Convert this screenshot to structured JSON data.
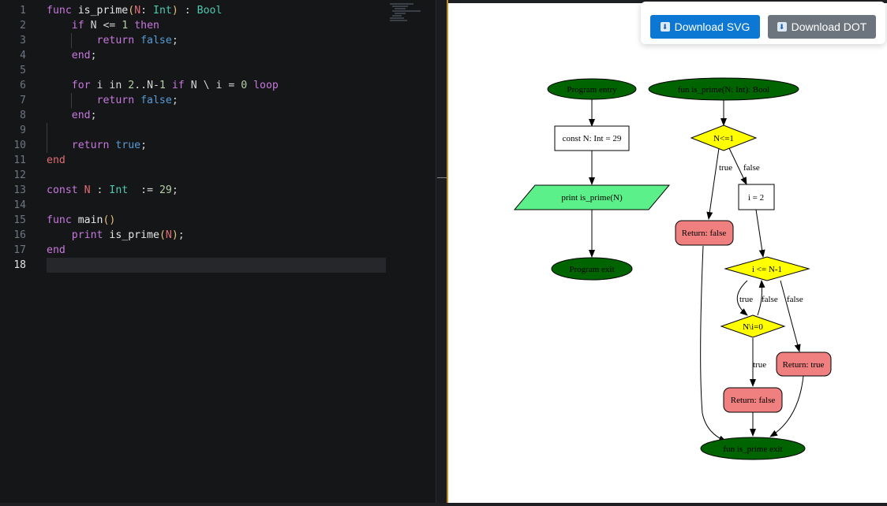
{
  "editor": {
    "line_numbers": [
      "1",
      "2",
      "3",
      "4",
      "5",
      "6",
      "7",
      "8",
      "9",
      "10",
      "11",
      "12",
      "13",
      "14",
      "15",
      "16",
      "17",
      "18"
    ],
    "active_line": "18",
    "lines": {
      "l1": {
        "kw": "func",
        "name": " is_prime",
        "p1": "(",
        "param": "N",
        "colon": ": ",
        "type": "Int",
        "p2": ")",
        "rest": " : ",
        "rtype": "Bool"
      },
      "l2": {
        "kw": "if",
        "cond": " N <= ",
        "num": "1",
        "then": " then"
      },
      "l3": {
        "kw": "return",
        "val": " false",
        "semi": ";"
      },
      "l4": {
        "kw": "end",
        "semi": ";"
      },
      "l6": {
        "kw": "for",
        "mid": " i in ",
        "num": "2",
        "mid2": "..N-",
        "num2": "1",
        "mid3": " ",
        "kw2": "if",
        "mid4": " N \\ i = ",
        "num3": "0",
        "kw3": " loop"
      },
      "l7": {
        "kw": "return",
        "val": " false",
        "semi": ";"
      },
      "l8": {
        "kw": "end",
        "semi": ";"
      },
      "l10": {
        "kw": "return",
        "val": " true",
        "semi": ";"
      },
      "l11": {
        "kw": "end"
      },
      "l13": {
        "kw": "const",
        "name": " N",
        "colon": " : ",
        "type": "Int",
        "assign": "  := ",
        "num": "29",
        "semi": ";"
      },
      "l15": {
        "kw": "func",
        "name": " main",
        "parens": "()"
      },
      "l16": {
        "kw": "print",
        "name": " is_prime",
        "p1": "(",
        "arg": "N",
        "p2": ")",
        "semi": ";"
      },
      "l17": {
        "kw": "end"
      }
    }
  },
  "toolbar": {
    "download_svg_label": "Download SVG",
    "download_dot_label": "Download DOT",
    "icon": "download-icon"
  },
  "graph": {
    "nodes": {
      "program_entry": "Program entry",
      "const_n": "const N: Int = 29",
      "print": "print is_prime(N)",
      "program_exit": "Program exit",
      "fun_entry": "fun is_prime(N: Int): Bool",
      "n_le_1": "N<=1",
      "i_eq_2": "i = 2",
      "return_false_1": "Return: false",
      "i_le_n1": "i <= N-1",
      "n_mod_i": "N\\i=0",
      "return_true": "Return: true",
      "return_false_2": "Return: false",
      "fun_exit": "fun is_prime exit"
    },
    "edge_labels": {
      "true_1": "true",
      "false_1": "false",
      "true_2": "true",
      "false_2": "false",
      "false_3": "false",
      "true_3": "true"
    }
  },
  "colors": {
    "entry_fill": "#006400",
    "decision_fill": "#ffff00",
    "print_fill": "#5cf08a",
    "return_fill": "#f08080",
    "download_svg_bg": "#0c78d4",
    "download_dot_bg": "#6c757d"
  }
}
